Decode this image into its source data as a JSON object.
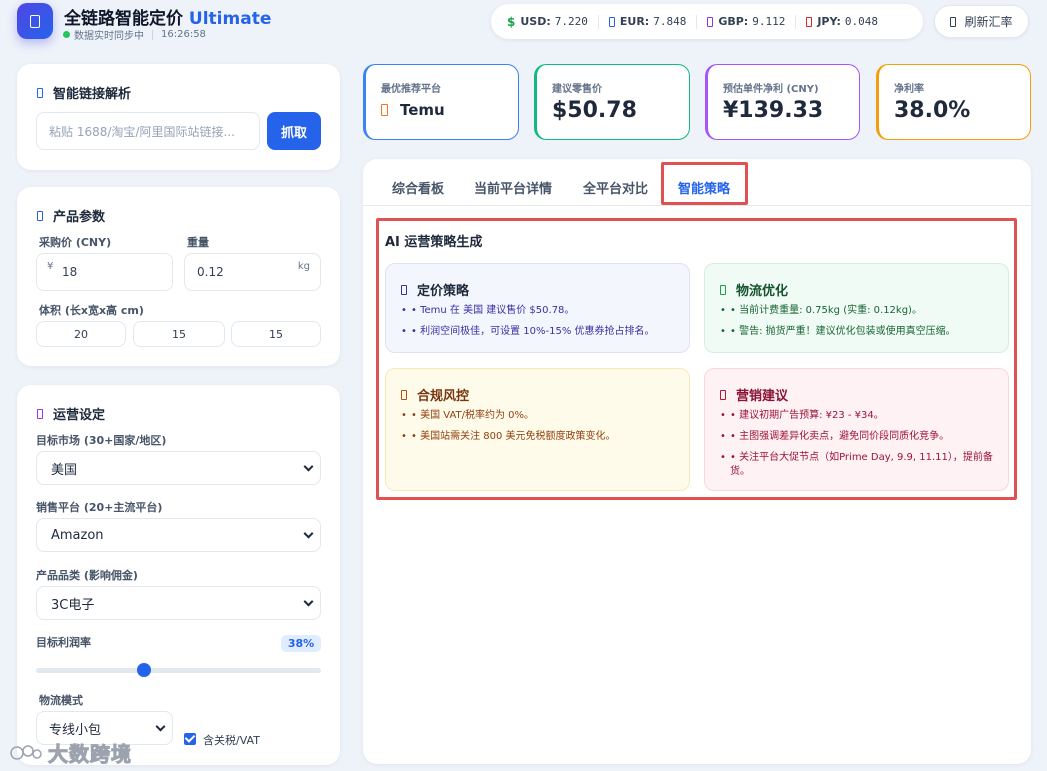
{
  "app": {
    "title": "全链路智能定价",
    "title_accent": "Ultimate",
    "sync_status": "数据实时同步中",
    "time": "16:26:58"
  },
  "rates": [
    {
      "currency": "USD:",
      "value": "7.220",
      "icon": "dollar-icon",
      "color": "#16a34a"
    },
    {
      "currency": "EUR:",
      "value": "7.848",
      "icon": "euro-icon",
      "color": "#2563eb"
    },
    {
      "currency": "GBP:",
      "value": "9.112",
      "icon": "pound-icon",
      "color": "#9333ea"
    },
    {
      "currency": "JPY:",
      "value": "0.048",
      "icon": "yen-icon",
      "color": "#dc2626"
    }
  ],
  "rates_usd_symbol": "$",
  "refresh_label": "刷新汇率",
  "link_parse": {
    "title": "智能链接解析",
    "placeholder": "粘贴 1688/淘宝/阿里国际站链接...",
    "fetch_label": "抓取"
  },
  "product_params": {
    "title": "产品参数",
    "purchase_price_label": "采购价 (CNY)",
    "currency_prefix": "¥",
    "purchase_price": "18",
    "weight_label": "重量",
    "weight": "0.12",
    "weight_unit": "kg",
    "volume_label": "体积 (长x宽x高 cm)",
    "length": "20",
    "width": "15",
    "height": "15"
  },
  "operations": {
    "title": "运营设定",
    "market_label": "目标市场 (30+国家/地区)",
    "market": "美国",
    "platform_label": "销售平台 (20+主流平台)",
    "platform": "Amazon",
    "category_label": "产品品类 (影响佣金)",
    "category": "3C电子",
    "margin_label": "目标利润率",
    "margin_display": "38%",
    "margin_value": 38,
    "logistics_label": "物流模式",
    "logistics": "专线小包",
    "tax_label": "含关税/VAT",
    "tax_checked": true
  },
  "kpis": [
    {
      "label": "最优推荐平台",
      "value": "Temu",
      "color": "#3b82f6"
    },
    {
      "label": "建议零售价",
      "value": "$50.78",
      "color": "#10b981"
    },
    {
      "label": "预估单件净利 (CNY)",
      "value": "¥139.33",
      "color": "#a855f7"
    },
    {
      "label": "净利率",
      "value": "38.0%",
      "color": "#f59e0b"
    }
  ],
  "tabs": [
    "综合看板",
    "当前平台详情",
    "全平台对比",
    "智能策略"
  ],
  "active_tab": "智能策略",
  "strategy": {
    "section_title": "AI 运营策略生成",
    "cards": [
      {
        "title": "定价策略",
        "bullets": [
          "• Temu 在 美国 建议售价 $50.78。",
          "• 利润空间极佳，可设置 10%-15% 优惠券抢占排名。"
        ]
      },
      {
        "title": "物流优化",
        "bullets": [
          "• 当前计费重量: 0.75kg (实重: 0.12kg)。",
          "• 警告: 抛货严重！建议优化包装或使用真空压缩。"
        ]
      },
      {
        "title": "合规风控",
        "bullets": [
          "• 美国 VAT/税率约为 0%。",
          "• 美国站需关注 800 美元免税额度政策变化。"
        ]
      },
      {
        "title": "营销建议",
        "bullets": [
          "• 建议初期广告预算: ¥23 - ¥34。",
          "• 主图强调差异化卖点，避免同价段同质化竞争。",
          "• 关注平台大促节点（如Prime Day, 9.9, 11.11），提前备货。"
        ]
      }
    ]
  },
  "watermark": "大数跨境"
}
